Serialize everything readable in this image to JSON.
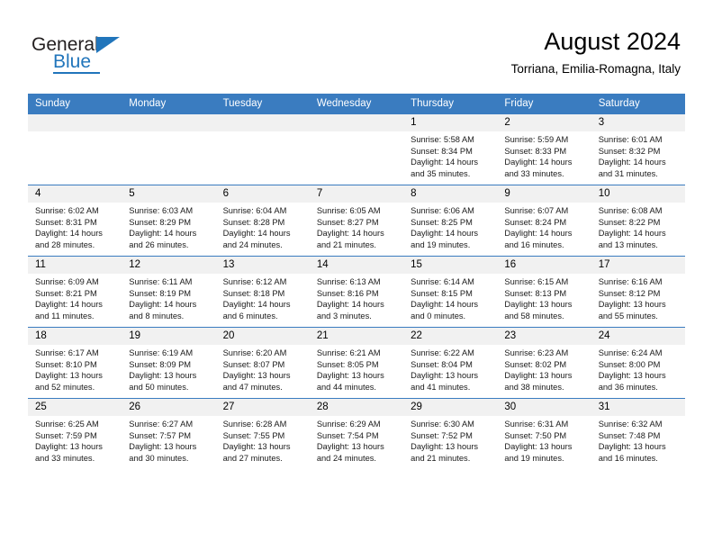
{
  "brand": {
    "name_part1": "General",
    "name_part2": "Blue",
    "accent_color": "#2175bb"
  },
  "header": {
    "title": "August 2024",
    "subtitle": "Torriana, Emilia-Romagna, Italy"
  },
  "theme": {
    "header_row_bg": "#3a7cc0",
    "daynum_bg": "#f1f1f1",
    "grid_line": "#3a7cc0"
  },
  "weekdays": [
    "Sunday",
    "Monday",
    "Tuesday",
    "Wednesday",
    "Thursday",
    "Friday",
    "Saturday"
  ],
  "labels": {
    "sunrise_prefix": "Sunrise:",
    "sunset_prefix": "Sunset:",
    "daylight_prefix": "Daylight:"
  },
  "weeks": [
    [
      {
        "day": "",
        "empty": true
      },
      {
        "day": "",
        "empty": true
      },
      {
        "day": "",
        "empty": true
      },
      {
        "day": "",
        "empty": true
      },
      {
        "day": "1",
        "sunrise": "Sunrise: 5:58 AM",
        "sunset": "Sunset: 8:34 PM",
        "daylight_l1": "Daylight: 14 hours",
        "daylight_l2": "and 35 minutes."
      },
      {
        "day": "2",
        "sunrise": "Sunrise: 5:59 AM",
        "sunset": "Sunset: 8:33 PM",
        "daylight_l1": "Daylight: 14 hours",
        "daylight_l2": "and 33 minutes."
      },
      {
        "day": "3",
        "sunrise": "Sunrise: 6:01 AM",
        "sunset": "Sunset: 8:32 PM",
        "daylight_l1": "Daylight: 14 hours",
        "daylight_l2": "and 31 minutes."
      }
    ],
    [
      {
        "day": "4",
        "sunrise": "Sunrise: 6:02 AM",
        "sunset": "Sunset: 8:31 PM",
        "daylight_l1": "Daylight: 14 hours",
        "daylight_l2": "and 28 minutes."
      },
      {
        "day": "5",
        "sunrise": "Sunrise: 6:03 AM",
        "sunset": "Sunset: 8:29 PM",
        "daylight_l1": "Daylight: 14 hours",
        "daylight_l2": "and 26 minutes."
      },
      {
        "day": "6",
        "sunrise": "Sunrise: 6:04 AM",
        "sunset": "Sunset: 8:28 PM",
        "daylight_l1": "Daylight: 14 hours",
        "daylight_l2": "and 24 minutes."
      },
      {
        "day": "7",
        "sunrise": "Sunrise: 6:05 AM",
        "sunset": "Sunset: 8:27 PM",
        "daylight_l1": "Daylight: 14 hours",
        "daylight_l2": "and 21 minutes."
      },
      {
        "day": "8",
        "sunrise": "Sunrise: 6:06 AM",
        "sunset": "Sunset: 8:25 PM",
        "daylight_l1": "Daylight: 14 hours",
        "daylight_l2": "and 19 minutes."
      },
      {
        "day": "9",
        "sunrise": "Sunrise: 6:07 AM",
        "sunset": "Sunset: 8:24 PM",
        "daylight_l1": "Daylight: 14 hours",
        "daylight_l2": "and 16 minutes."
      },
      {
        "day": "10",
        "sunrise": "Sunrise: 6:08 AM",
        "sunset": "Sunset: 8:22 PM",
        "daylight_l1": "Daylight: 14 hours",
        "daylight_l2": "and 13 minutes."
      }
    ],
    [
      {
        "day": "11",
        "sunrise": "Sunrise: 6:09 AM",
        "sunset": "Sunset: 8:21 PM",
        "daylight_l1": "Daylight: 14 hours",
        "daylight_l2": "and 11 minutes."
      },
      {
        "day": "12",
        "sunrise": "Sunrise: 6:11 AM",
        "sunset": "Sunset: 8:19 PM",
        "daylight_l1": "Daylight: 14 hours",
        "daylight_l2": "and 8 minutes."
      },
      {
        "day": "13",
        "sunrise": "Sunrise: 6:12 AM",
        "sunset": "Sunset: 8:18 PM",
        "daylight_l1": "Daylight: 14 hours",
        "daylight_l2": "and 6 minutes."
      },
      {
        "day": "14",
        "sunrise": "Sunrise: 6:13 AM",
        "sunset": "Sunset: 8:16 PM",
        "daylight_l1": "Daylight: 14 hours",
        "daylight_l2": "and 3 minutes."
      },
      {
        "day": "15",
        "sunrise": "Sunrise: 6:14 AM",
        "sunset": "Sunset: 8:15 PM",
        "daylight_l1": "Daylight: 14 hours",
        "daylight_l2": "and 0 minutes."
      },
      {
        "day": "16",
        "sunrise": "Sunrise: 6:15 AM",
        "sunset": "Sunset: 8:13 PM",
        "daylight_l1": "Daylight: 13 hours",
        "daylight_l2": "and 58 minutes."
      },
      {
        "day": "17",
        "sunrise": "Sunrise: 6:16 AM",
        "sunset": "Sunset: 8:12 PM",
        "daylight_l1": "Daylight: 13 hours",
        "daylight_l2": "and 55 minutes."
      }
    ],
    [
      {
        "day": "18",
        "sunrise": "Sunrise: 6:17 AM",
        "sunset": "Sunset: 8:10 PM",
        "daylight_l1": "Daylight: 13 hours",
        "daylight_l2": "and 52 minutes."
      },
      {
        "day": "19",
        "sunrise": "Sunrise: 6:19 AM",
        "sunset": "Sunset: 8:09 PM",
        "daylight_l1": "Daylight: 13 hours",
        "daylight_l2": "and 50 minutes."
      },
      {
        "day": "20",
        "sunrise": "Sunrise: 6:20 AM",
        "sunset": "Sunset: 8:07 PM",
        "daylight_l1": "Daylight: 13 hours",
        "daylight_l2": "and 47 minutes."
      },
      {
        "day": "21",
        "sunrise": "Sunrise: 6:21 AM",
        "sunset": "Sunset: 8:05 PM",
        "daylight_l1": "Daylight: 13 hours",
        "daylight_l2": "and 44 minutes."
      },
      {
        "day": "22",
        "sunrise": "Sunrise: 6:22 AM",
        "sunset": "Sunset: 8:04 PM",
        "daylight_l1": "Daylight: 13 hours",
        "daylight_l2": "and 41 minutes."
      },
      {
        "day": "23",
        "sunrise": "Sunrise: 6:23 AM",
        "sunset": "Sunset: 8:02 PM",
        "daylight_l1": "Daylight: 13 hours",
        "daylight_l2": "and 38 minutes."
      },
      {
        "day": "24",
        "sunrise": "Sunrise: 6:24 AM",
        "sunset": "Sunset: 8:00 PM",
        "daylight_l1": "Daylight: 13 hours",
        "daylight_l2": "and 36 minutes."
      }
    ],
    [
      {
        "day": "25",
        "sunrise": "Sunrise: 6:25 AM",
        "sunset": "Sunset: 7:59 PM",
        "daylight_l1": "Daylight: 13 hours",
        "daylight_l2": "and 33 minutes."
      },
      {
        "day": "26",
        "sunrise": "Sunrise: 6:27 AM",
        "sunset": "Sunset: 7:57 PM",
        "daylight_l1": "Daylight: 13 hours",
        "daylight_l2": "and 30 minutes."
      },
      {
        "day": "27",
        "sunrise": "Sunrise: 6:28 AM",
        "sunset": "Sunset: 7:55 PM",
        "daylight_l1": "Daylight: 13 hours",
        "daylight_l2": "and 27 minutes."
      },
      {
        "day": "28",
        "sunrise": "Sunrise: 6:29 AM",
        "sunset": "Sunset: 7:54 PM",
        "daylight_l1": "Daylight: 13 hours",
        "daylight_l2": "and 24 minutes."
      },
      {
        "day": "29",
        "sunrise": "Sunrise: 6:30 AM",
        "sunset": "Sunset: 7:52 PM",
        "daylight_l1": "Daylight: 13 hours",
        "daylight_l2": "and 21 minutes."
      },
      {
        "day": "30",
        "sunrise": "Sunrise: 6:31 AM",
        "sunset": "Sunset: 7:50 PM",
        "daylight_l1": "Daylight: 13 hours",
        "daylight_l2": "and 19 minutes."
      },
      {
        "day": "31",
        "sunrise": "Sunrise: 6:32 AM",
        "sunset": "Sunset: 7:48 PM",
        "daylight_l1": "Daylight: 13 hours",
        "daylight_l2": "and 16 minutes."
      }
    ]
  ]
}
